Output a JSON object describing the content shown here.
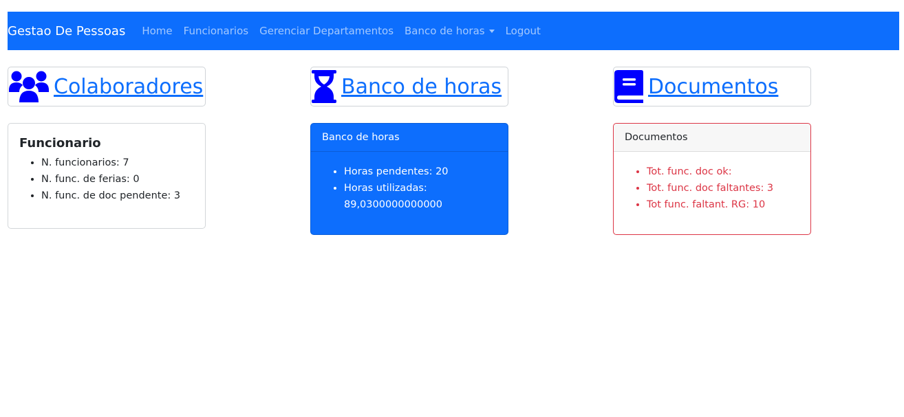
{
  "navbar": {
    "brand": "Gestao De Pessoas",
    "links": [
      "Home",
      "Funcionarios",
      "Gerenciar Departamentos",
      "Banco de horas",
      "Logout"
    ]
  },
  "colaboradores": {
    "icon": "users-icon",
    "link": "Colaboradores",
    "card_title": "Funcionario",
    "items": [
      "N. funcionarios: 7",
      "N. func. de ferias: 0",
      "N. func. de doc pendente: 3"
    ]
  },
  "banco": {
    "icon": "hourglass-icon",
    "link": "Banco de horas",
    "card_header": "Banco de horas",
    "items": [
      "Horas pendentes: 20",
      "Horas utilizadas: 89,0300000000000"
    ]
  },
  "documentos": {
    "icon": "book-icon",
    "link": "Documentos",
    "card_header": "Documentos",
    "items": [
      "Tot. func. doc ok:",
      "Tot. func. doc faltantes: 3",
      "Tot func. faltant. RG: 10"
    ]
  },
  "colors": {
    "primary": "#0d6efd",
    "icon": "#0000ff",
    "danger": "#dc3545"
  }
}
